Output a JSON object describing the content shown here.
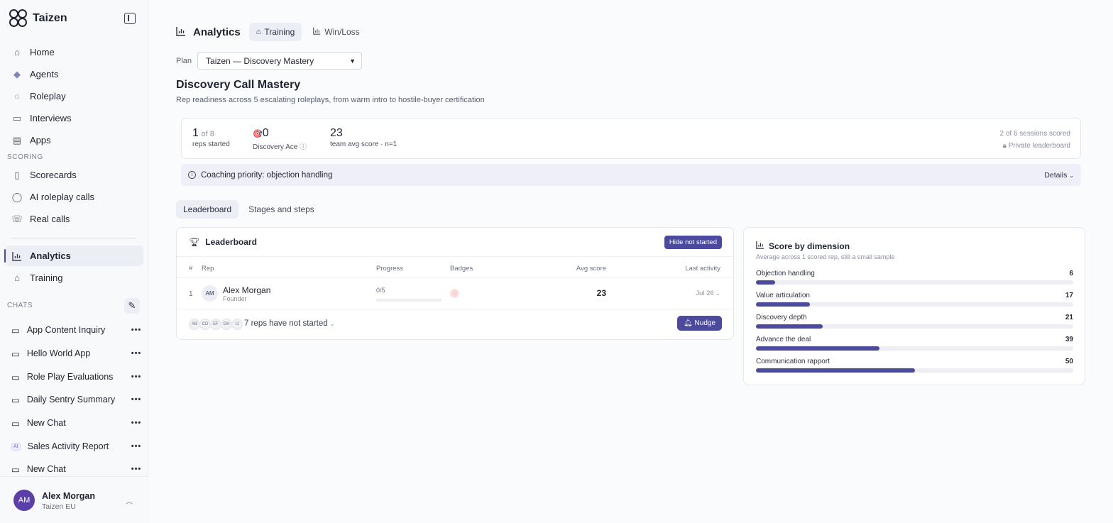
{
  "app": {
    "name": "Taizen"
  },
  "nav": {
    "home": "Home",
    "agents": "Agents",
    "roleplay": "Roleplay",
    "interviews": "Interviews",
    "apps": "Apps",
    "scoring_label": "SCORING",
    "scorecards": "Scorecards",
    "ai_roleplay_calls": "AI roleplay calls",
    "real_calls": "Real calls",
    "analytics": "Analytics",
    "training": "Training"
  },
  "chats": {
    "label": "CHATS",
    "items": [
      {
        "title": "App Content Inquiry"
      },
      {
        "title": "Hello World App"
      },
      {
        "title": "Role Play Evaluations"
      },
      {
        "title": "Daily Sentry Summary"
      },
      {
        "title": "New Chat"
      },
      {
        "title": "Sales Activity Report",
        "badge": "AI"
      },
      {
        "title": "New Chat"
      }
    ]
  },
  "user": {
    "initials": "AM",
    "name": "Alex Morgan",
    "org": "Taizen EU"
  },
  "header": {
    "title": "Analytics",
    "tabs": [
      {
        "label": "Training",
        "active": true
      },
      {
        "label": "Win/Loss",
        "active": false
      }
    ]
  },
  "plan": {
    "label": "Plan",
    "selected": "Taizen — Discovery Mastery"
  },
  "course": {
    "title": "Discovery Call Mastery",
    "subtitle": "Rep readiness across 5 escalating roleplays, from warm intro to hostile-buyer certification"
  },
  "stats": {
    "reps_started": "1",
    "reps_total": "of 8",
    "reps_label": "reps started",
    "ace_count": "0",
    "ace_label": "Discovery Ace",
    "team_avg": "23",
    "team_avg_label": "team avg score · n=1",
    "sessions_scored": "2 of 6 sessions scored",
    "private_label": "Private leaderboard"
  },
  "coaching": {
    "text": "Coaching priority: objection handling",
    "details": "Details"
  },
  "subtabs": [
    {
      "label": "Leaderboard",
      "active": true
    },
    {
      "label": "Stages and steps",
      "active": false
    }
  ],
  "leaderboard": {
    "title": "Leaderboard",
    "hide_button": "Hide not started",
    "columns": {
      "num": "#",
      "rep": "Rep",
      "progress": "Progress",
      "badges": "Badges",
      "avg": "Avg score",
      "activity": "Last activity"
    },
    "rows": [
      {
        "rank": "1",
        "initials": "AM",
        "name": "Alex Morgan",
        "role": "Founder",
        "progress_text": "0/5",
        "progress": 0,
        "avg": "23",
        "activity": "Jul 26"
      }
    ],
    "not_started_initials": [
      "AB",
      "CD",
      "EF",
      "GH",
      "IJ"
    ],
    "not_started_text": "7 reps have not started",
    "nudge_button": "Nudge"
  },
  "dimensions": {
    "title": "Score by dimension",
    "subtitle": "Average across 1 scored rep, still a small sample",
    "max": 100,
    "items": [
      {
        "label": "Objection handling",
        "value": 6
      },
      {
        "label": "Value articulation",
        "value": 17
      },
      {
        "label": "Discovery depth",
        "value": 21
      },
      {
        "label": "Advance the deal",
        "value": 39
      },
      {
        "label": "Communication rapport",
        "value": 50
      }
    ]
  },
  "colors": {
    "accent": "#4b4a9c",
    "avatar": "#5b3fa8"
  }
}
